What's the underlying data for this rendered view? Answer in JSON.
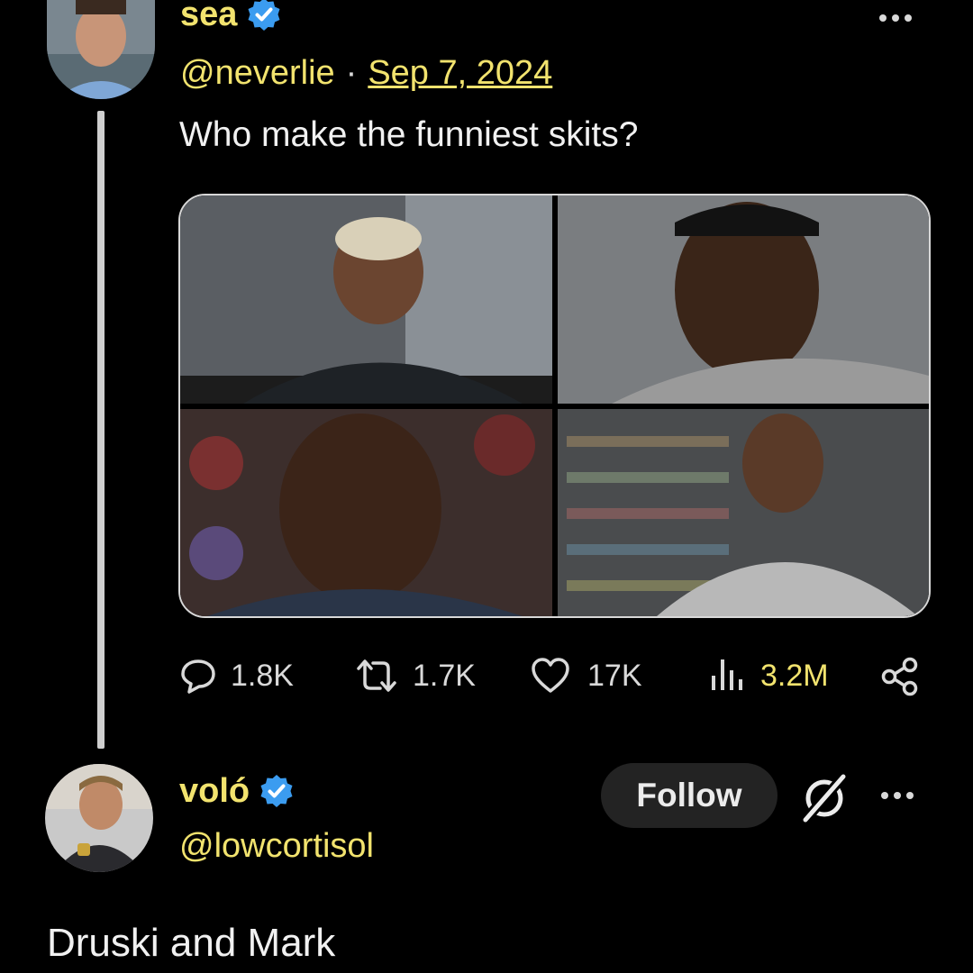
{
  "parent": {
    "display_name": "sea",
    "handle": "@neverlie",
    "separator": "·",
    "date": "Sep 7, 2024",
    "text": "Who make the funniest skits?",
    "stats": {
      "replies": "1.8K",
      "reposts": "1.7K",
      "likes": "17K",
      "views": "3.2M"
    }
  },
  "reply": {
    "display_name": "voló",
    "handle": "@lowcortisol",
    "follow_label": "Follow",
    "text": "Druski and Mark"
  },
  "colors": {
    "accent": "#f2e36e",
    "verified": "#3b9cf0",
    "background": "#000000",
    "muted": "#d9d9d9"
  },
  "icons": [
    "verified-badge-icon",
    "more-icon",
    "reply-icon",
    "repost-icon",
    "like-icon",
    "views-icon",
    "share-icon",
    "grok-icon"
  ]
}
